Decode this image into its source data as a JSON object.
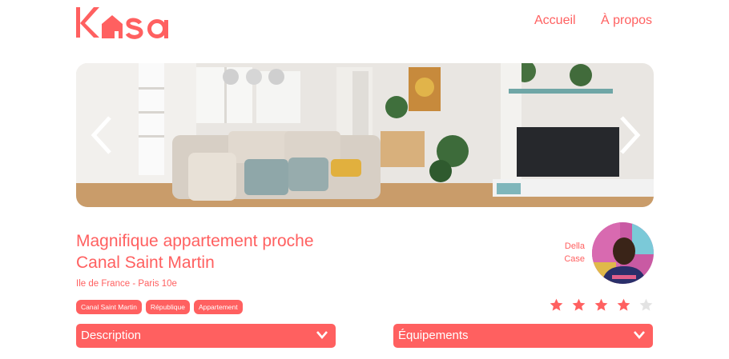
{
  "header": {
    "logo_text": "Kasa",
    "nav": [
      {
        "label": "Accueil"
      },
      {
        "label": "À propos"
      }
    ]
  },
  "carousel": {
    "prev_icon": "chevron-left-icon",
    "next_icon": "chevron-right-icon"
  },
  "listing": {
    "title_line1": "Magnifique appartement proche",
    "title_line2": "Canal Saint Martin",
    "location": "Ile de France - Paris 10e",
    "tags": [
      "Canal Saint Martin",
      "République",
      "Appartement"
    ],
    "host": {
      "first_name": "Della",
      "last_name": "Case"
    },
    "rating": 4,
    "rating_max": 5
  },
  "collapses": {
    "description_label": "Description",
    "equipments_label": "Équipements"
  },
  "colors": {
    "primary": "#FF6060",
    "star_off": "#E3E3E3"
  }
}
